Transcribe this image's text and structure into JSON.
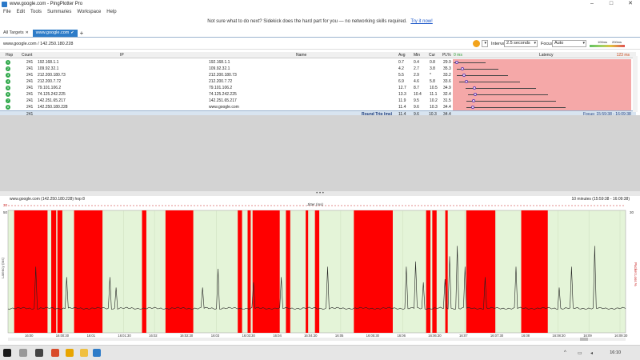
{
  "window": {
    "title": "www.google.com - PingPlotter Pro"
  },
  "menu": [
    "File",
    "Edit",
    "Tools",
    "Summaries",
    "Workspace",
    "Help"
  ],
  "banner": {
    "text": "Not sure what to do next? Sidekick does the hard part for you — no networking skills required.",
    "link": "Try it now!"
  },
  "tabs": {
    "all_targets": "All Targets",
    "active": "www.google.com"
  },
  "target": {
    "label": "www.google.com / 142.250.180.228"
  },
  "controls": {
    "interval_label": "Interval",
    "interval_value": "2.5 seconds",
    "focus_label": "Focus",
    "focus_value": "Auto",
    "scale_low": "100ms",
    "scale_high": "200ms"
  },
  "table": {
    "headers": {
      "hop": "Hop",
      "count": "Count",
      "ip": "IP",
      "name": "Name",
      "avg": "Avg",
      "min": "Min",
      "cur": "Cur",
      "pl": "PL%",
      "latency": "Latency",
      "lat_low": "0 ms",
      "lat_high": "123 ms"
    },
    "rows": [
      {
        "hop": "1",
        "count": "241",
        "ip": "192.168.1.1",
        "name": "192.168.1.1",
        "avg": "0.7",
        "min": "0.4",
        "cur": "0.8",
        "pl": "29.9"
      },
      {
        "hop": "2",
        "count": "241",
        "ip": "109.92.32.1",
        "name": "109.92.32.1",
        "avg": "4.2",
        "min": "2.7",
        "cur": "3.8",
        "pl": "35.3"
      },
      {
        "hop": "3",
        "count": "241",
        "ip": "212.200.180.73",
        "name": "212.200.180.73",
        "avg": "5.5",
        "min": "2.9",
        "cur": "*",
        "pl": "33.2"
      },
      {
        "hop": "4",
        "count": "241",
        "ip": "212.200.7.72",
        "name": "212.200.7.72",
        "avg": "6.9",
        "min": "4.6",
        "cur": "5.8",
        "pl": "33.6"
      },
      {
        "hop": "5",
        "count": "241",
        "ip": "79.101.106.2",
        "name": "79.101.106.2",
        "avg": "12.7",
        "min": "8.7",
        "cur": "10.5",
        "pl": "34.9"
      },
      {
        "hop": "6",
        "count": "241",
        "ip": "74.125.242.225",
        "name": "74.125.242.225",
        "avg": "13.3",
        "min": "10.4",
        "cur": "11.1",
        "pl": "32.4"
      },
      {
        "hop": "7",
        "count": "241",
        "ip": "142.251.65.217",
        "name": "142.251.65.217",
        "avg": "11.9",
        "min": "9.5",
        "cur": "10.2",
        "pl": "31.5"
      },
      {
        "hop": "8",
        "count": "241",
        "ip": "142.250.180.228",
        "name": "www.google.com",
        "avg": "11.4",
        "min": "9.6",
        "cur": "10.3",
        "pl": "34.4"
      }
    ],
    "total": {
      "count": "241",
      "label": "Round Trip (ms)",
      "avg": "11.4",
      "min": "9.6",
      "cur": "10.3",
      "pl": "34.4",
      "focus": "Focus: 15:59:38 - 16:09:38"
    }
  },
  "graph": {
    "title": "www.google.com (142.250.180.228) hop 8",
    "range": "10 minutes (15:59:38 - 16:09:38)",
    "jitter_label": "Jitter (ms)",
    "y_top": "50",
    "y_left_label": "Latency (ms)",
    "y_right_label": "Packet Loss %",
    "y_right_top": "30",
    "x_labels": [
      "16:00",
      "16:00:30",
      "16:01",
      "16:01:30",
      "16:02",
      "16:02:30",
      "16:03",
      "16:03:30",
      "16:04",
      "16:04:30",
      "16:05",
      "16:05:30",
      "16:06",
      "16:06:30",
      "16:07",
      "16:07:30",
      "16:08",
      "16:08:30",
      "16:09",
      "16:09:30"
    ],
    "loss_blocks": [
      [
        0.01,
        0.06
      ],
      [
        0.057,
        0.064
      ],
      [
        0.07,
        0.078
      ],
      [
        0.08,
        0.088
      ],
      [
        0.107,
        0.153
      ],
      [
        0.217,
        0.224
      ],
      [
        0.255,
        0.3
      ],
      [
        0.372,
        0.379
      ],
      [
        0.388,
        0.393
      ],
      [
        0.396,
        0.44
      ],
      [
        0.45,
        0.457
      ],
      [
        0.482,
        0.486
      ],
      [
        0.497,
        0.504
      ],
      [
        0.56,
        0.623
      ],
      [
        0.677,
        0.684
      ],
      [
        0.687,
        0.694
      ],
      [
        0.708,
        0.712
      ],
      [
        0.742,
        0.789
      ],
      [
        0.831,
        0.874
      ]
    ],
    "spikes": [
      [
        0.045,
        0.4
      ],
      [
        0.094,
        0.3
      ],
      [
        0.165,
        0.3
      ],
      [
        0.175,
        0.2
      ],
      [
        0.315,
        0.2
      ],
      [
        0.341,
        0.38
      ],
      [
        0.398,
        0.25
      ],
      [
        0.443,
        0.3
      ],
      [
        0.517,
        0.4
      ],
      [
        0.645,
        0.4
      ],
      [
        0.661,
        0.45
      ],
      [
        0.673,
        0.25
      ],
      [
        0.707,
        0.28
      ],
      [
        0.716,
        0.5
      ],
      [
        0.728,
        0.6
      ],
      [
        0.741,
        0.4
      ],
      [
        0.773,
        0.3
      ],
      [
        0.822,
        0.4
      ],
      [
        0.892,
        0.2
      ],
      [
        0.912,
        0.4
      ],
      [
        0.95,
        0.6
      ]
    ]
  },
  "taskbar": {
    "time": "16:10"
  }
}
